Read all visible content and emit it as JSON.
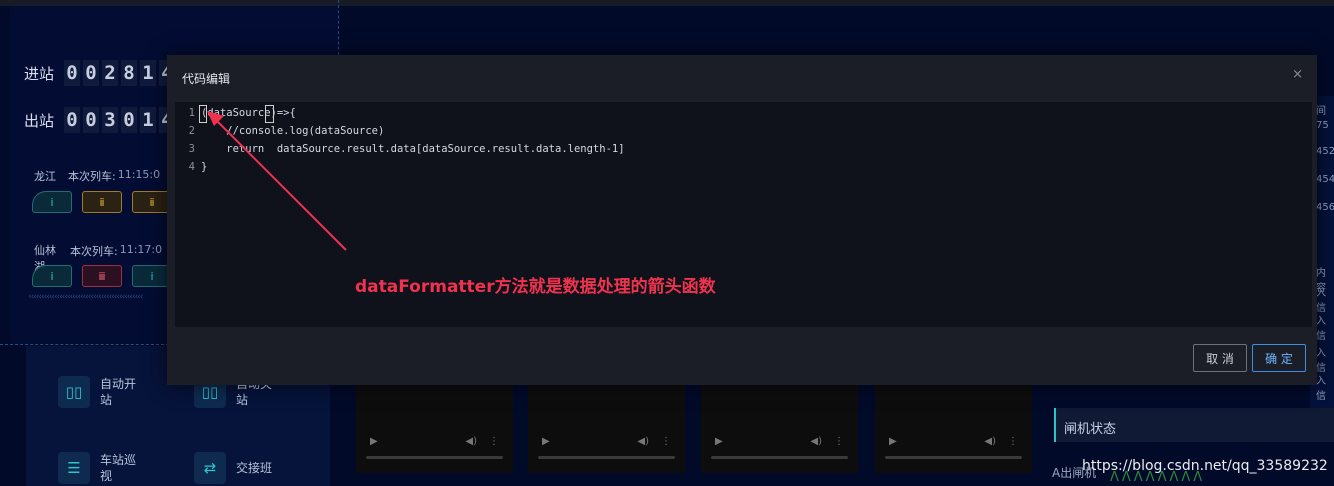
{
  "background": {
    "counters": [
      {
        "label": "进站",
        "digits": [
          "0",
          "0",
          "2",
          "8",
          "1",
          "4"
        ]
      },
      {
        "label": "出站",
        "digits": [
          "0",
          "0",
          "3",
          "0",
          "1",
          "4"
        ]
      }
    ],
    "stations": [
      {
        "name": "龙江",
        "next_label": "本次列车:",
        "time": "11:15:0"
      },
      {
        "name": "仙林湖",
        "next_label": "本次列车:",
        "time": "11:17:0"
      }
    ],
    "chevrons": "‹‹‹‹‹‹‹‹‹‹‹‹‹‹‹‹‹‹‹‹‹‹‹‹‹‹‹‹‹‹‹‹‹‹‹‹‹‹‹‹‹‹‹‹",
    "functions": [
      {
        "label": "自动开站",
        "icon": "station-door-icon"
      },
      {
        "label": "自动关站",
        "icon": "station-door-icon"
      },
      {
        "label": "车站巡视",
        "icon": "patrol-icon"
      },
      {
        "label": "交接班",
        "icon": "shift-swap-icon"
      }
    ],
    "right_strip": [
      "间",
      "75",
      "452",
      "454",
      "456",
      "内容",
      "入信",
      "入信",
      "入信",
      "入信"
    ],
    "gate_status_title": "闸机状态",
    "gate_a_label": "A出闸机",
    "watermark": "https://blog.csdn.net/qq_33589232"
  },
  "dialog": {
    "title": "代码编辑",
    "close_glyph": "×",
    "code_lines": [
      {
        "no": "1",
        "text": "(dataSource)=>{"
      },
      {
        "no": "2",
        "text": "    //console.log(dataSource)"
      },
      {
        "no": "3",
        "text": "    return  dataSource.result.data[dataSource.result.data.length-1]"
      },
      {
        "no": "4",
        "text": "}"
      }
    ],
    "annotation": "dataFormatter方法就是数据处理的箭头函数",
    "cancel_label": "取 消",
    "ok_label": "确 定"
  },
  "colors": {
    "annotation": "#f0324e",
    "ok_accent": "#3a8ee6",
    "teal": "#29c7c0"
  }
}
